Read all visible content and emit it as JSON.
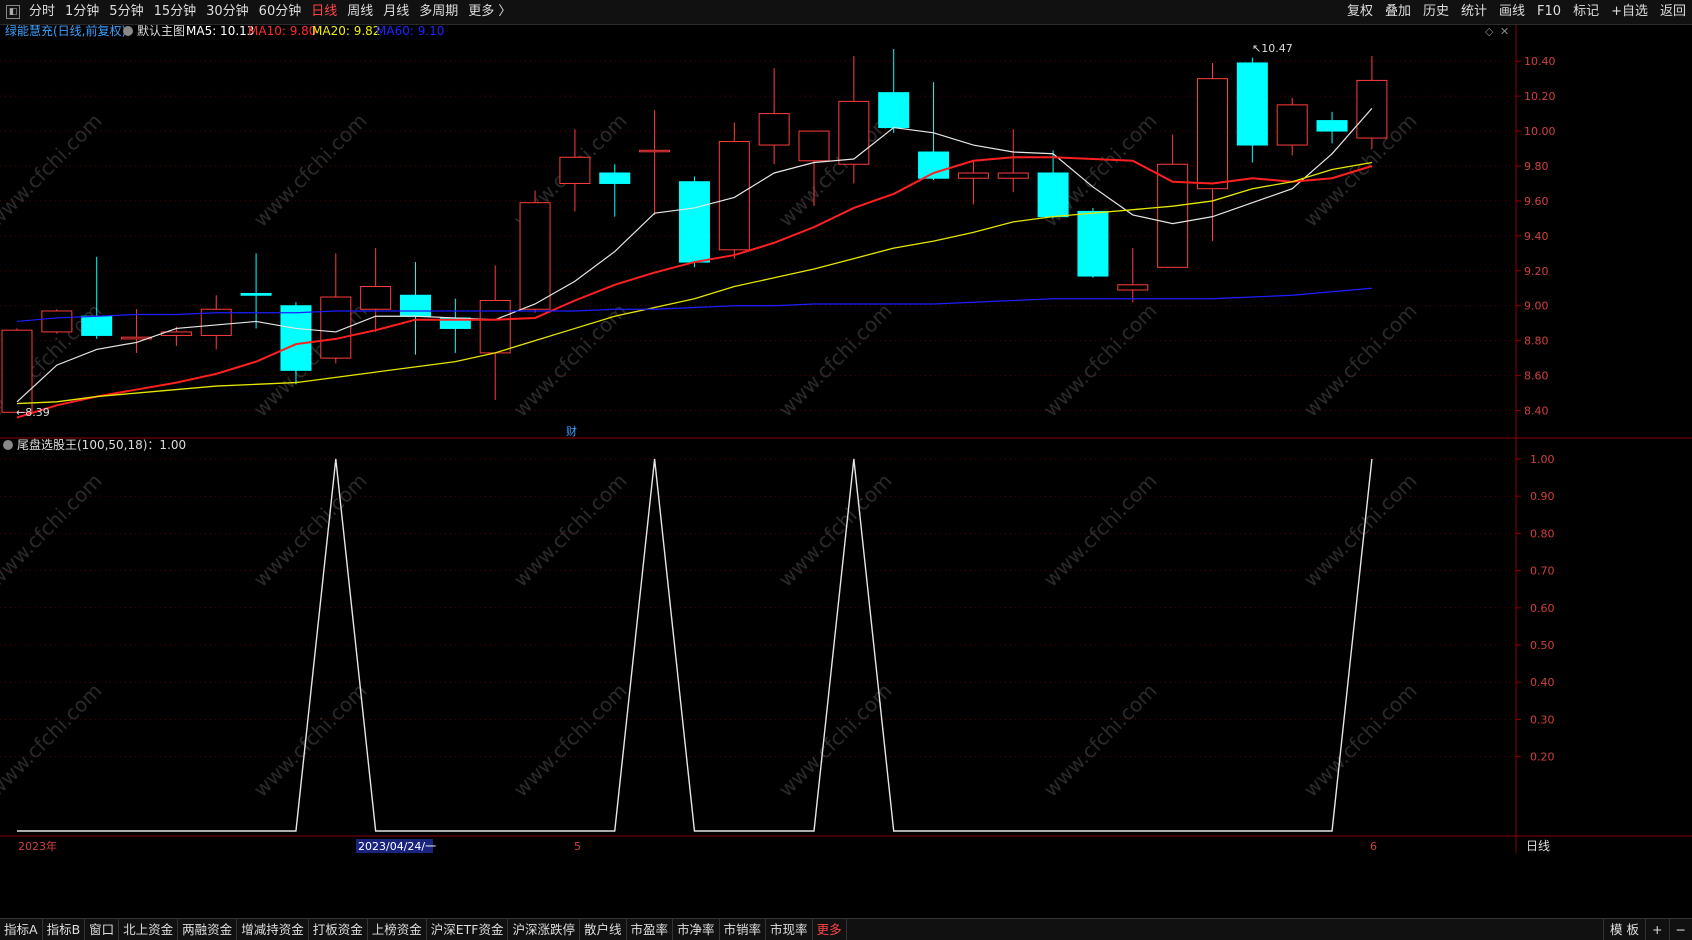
{
  "topbar": {
    "periods": [
      "分时",
      "1分钟",
      "5分钟",
      "15分钟",
      "30分钟",
      "60分钟",
      "日线",
      "周线",
      "月线",
      "多周期",
      "更多 〉"
    ],
    "active_period": "日线",
    "actions": [
      "复权",
      "叠加",
      "历史",
      "统计",
      "画线",
      "F10",
      "标记",
      "+自选",
      "返回"
    ]
  },
  "main_panel": {
    "stock_name": "绿能慧充(日线,前复权)",
    "template": "默认主图",
    "ma_labels": [
      {
        "text": "MA5: 10.13",
        "color": "#ffffff"
      },
      {
        "text": "MA10: 9.80",
        "color": "#ff2b2b"
      },
      {
        "text": "MA20: 9.82",
        "color": "#f0f000"
      },
      {
        "text": "MA60: 9.10",
        "color": "#2323ff"
      }
    ],
    "high_marker": "10.47",
    "low_marker": "8.39",
    "finance_marker": "财",
    "y_ticks": [
      "10.40",
      "10.20",
      "10.00",
      "9.80",
      "9.60",
      "9.40",
      "9.20",
      "9.00",
      "8.80",
      "8.60",
      "8.40"
    ]
  },
  "indicator_panel": {
    "title": "尾盘选股王(100,50,18)：1.00",
    "y_ticks": [
      "1.00",
      "0.90",
      "0.80",
      "0.70",
      "0.60",
      "0.50",
      "0.40",
      "0.30",
      "0.20"
    ]
  },
  "x_axis": {
    "labels": [
      "2023年",
      "5",
      "6"
    ],
    "cursor_label": "2023/04/24/一",
    "period_label": "日线"
  },
  "watermark": "www.cfchi.com",
  "bottombar": {
    "tabs": [
      "指标A",
      "指标B",
      "窗口",
      "北上资金",
      "两融资金",
      "增减持资金",
      "打板资金",
      "上榜资金",
      "沪深ETF资金",
      "沪深涨跌停",
      "散户线",
      "市盈率",
      "市净率",
      "市销率",
      "市现率",
      "更多"
    ],
    "right": [
      "模 板",
      "+",
      "−"
    ]
  },
  "colors": {
    "up": "#ff3c3c",
    "down": "#00ffff",
    "ma5": "#e6e6e6",
    "ma10": "#ff2020",
    "ma20": "#e6e600",
    "ma60": "#1e1eff",
    "indicator": "#e6e6e6",
    "grid": "#5a0000"
  },
  "chart_data": [
    {
      "type": "candlestick",
      "title": "绿能慧充(日线,前复权)",
      "ylim": [
        8.3,
        10.55
      ],
      "candles": [
        {
          "o": 8.39,
          "h": 8.87,
          "l": 8.39,
          "c": 8.86
        },
        {
          "o": 8.85,
          "h": 8.98,
          "l": 8.84,
          "c": 8.97
        },
        {
          "o": 8.94,
          "h": 9.28,
          "l": 8.81,
          "c": 8.83
        },
        {
          "o": 8.81,
          "h": 8.98,
          "l": 8.73,
          "c": 8.82
        },
        {
          "o": 8.83,
          "h": 8.88,
          "l": 8.77,
          "c": 8.85
        },
        {
          "o": 8.83,
          "h": 9.06,
          "l": 8.75,
          "c": 8.98
        },
        {
          "o": 9.07,
          "h": 9.3,
          "l": 8.87,
          "c": 9.06
        },
        {
          "o": 9.0,
          "h": 9.02,
          "l": 8.55,
          "c": 8.63
        },
        {
          "o": 8.7,
          "h": 9.3,
          "l": 8.67,
          "c": 9.05
        },
        {
          "o": 8.98,
          "h": 9.33,
          "l": 8.85,
          "c": 9.11
        },
        {
          "o": 9.06,
          "h": 9.25,
          "l": 8.72,
          "c": 8.94
        },
        {
          "o": 8.93,
          "h": 9.04,
          "l": 8.73,
          "c": 8.87
        },
        {
          "o": 8.73,
          "h": 9.23,
          "l": 8.46,
          "c": 9.03
        },
        {
          "o": 8.98,
          "h": 9.66,
          "l": 8.96,
          "c": 9.59
        },
        {
          "o": 9.7,
          "h": 10.01,
          "l": 9.54,
          "c": 9.85
        },
        {
          "o": 9.76,
          "h": 9.81,
          "l": 9.51,
          "c": 9.7
        },
        {
          "o": 9.89,
          "h": 10.12,
          "l": 9.52,
          "c": 9.89
        },
        {
          "o": 9.71,
          "h": 9.74,
          "l": 9.22,
          "c": 9.25
        },
        {
          "o": 9.32,
          "h": 10.05,
          "l": 9.27,
          "c": 9.94
        },
        {
          "o": 9.92,
          "h": 10.36,
          "l": 9.81,
          "c": 10.1
        },
        {
          "o": 9.83,
          "h": 10.0,
          "l": 9.57,
          "c": 10.0
        },
        {
          "o": 9.81,
          "h": 10.43,
          "l": 9.7,
          "c": 10.17
        },
        {
          "o": 10.22,
          "h": 10.47,
          "l": 9.99,
          "c": 10.02
        },
        {
          "o": 9.88,
          "h": 10.28,
          "l": 9.72,
          "c": 9.73
        },
        {
          "o": 9.73,
          "h": 9.83,
          "l": 9.58,
          "c": 9.76
        },
        {
          "o": 9.73,
          "h": 10.01,
          "l": 9.65,
          "c": 9.76
        },
        {
          "o": 9.76,
          "h": 9.89,
          "l": 9.5,
          "c": 9.51
        },
        {
          "o": 9.54,
          "h": 9.56,
          "l": 9.16,
          "c": 9.17
        },
        {
          "o": 9.09,
          "h": 9.33,
          "l": 9.02,
          "c": 9.12
        },
        {
          "o": 9.22,
          "h": 9.98,
          "l": 9.22,
          "c": 9.81
        },
        {
          "o": 9.67,
          "h": 10.39,
          "l": 9.37,
          "c": 10.3
        },
        {
          "o": 10.39,
          "h": 10.42,
          "l": 9.82,
          "c": 9.92
        },
        {
          "o": 9.92,
          "h": 10.19,
          "l": 9.86,
          "c": 10.15
        },
        {
          "o": 10.06,
          "h": 10.11,
          "l": 9.93,
          "c": 10.0
        },
        {
          "o": 9.96,
          "h": 10.43,
          "l": 9.9,
          "c": 10.29
        }
      ],
      "series": [
        {
          "name": "MA5",
          "values": [
            8.45,
            8.66,
            8.75,
            8.79,
            8.87,
            8.89,
            8.91,
            8.87,
            8.85,
            8.94,
            8.94,
            8.93,
            8.92,
            9.01,
            9.14,
            9.31,
            9.53,
            9.56,
            9.62,
            9.76,
            9.82,
            9.84,
            10.02,
            9.99,
            9.92,
            9.88,
            9.87,
            9.68,
            9.52,
            9.47,
            9.51,
            9.59,
            9.67,
            9.87,
            10.13
          ]
        },
        {
          "name": "MA10",
          "values": [
            8.36,
            8.43,
            8.48,
            8.52,
            8.56,
            8.61,
            8.68,
            8.78,
            8.81,
            8.86,
            8.92,
            8.92,
            8.92,
            8.93,
            9.03,
            9.12,
            9.19,
            9.25,
            9.29,
            9.36,
            9.45,
            9.56,
            9.64,
            9.76,
            9.83,
            9.85,
            9.85,
            9.84,
            9.83,
            9.71,
            9.7,
            9.73,
            9.71,
            9.73,
            9.8
          ]
        },
        {
          "name": "MA20",
          "values": [
            8.44,
            8.45,
            8.48,
            8.5,
            8.52,
            8.54,
            8.55,
            8.56,
            8.59,
            8.62,
            8.65,
            8.68,
            8.73,
            8.8,
            8.87,
            8.94,
            8.99,
            9.04,
            9.11,
            9.16,
            9.21,
            9.27,
            9.33,
            9.37,
            9.42,
            9.48,
            9.51,
            9.53,
            9.55,
            9.57,
            9.6,
            9.67,
            9.71,
            9.78,
            9.82
          ]
        },
        {
          "name": "MA60",
          "values": [
            8.91,
            8.93,
            8.94,
            8.95,
            8.95,
            8.96,
            8.96,
            8.96,
            8.97,
            8.97,
            8.97,
            8.97,
            8.97,
            8.97,
            8.97,
            8.98,
            8.98,
            8.99,
            9.0,
            9.0,
            9.01,
            9.01,
            9.01,
            9.01,
            9.02,
            9.03,
            9.04,
            9.04,
            9.04,
            9.04,
            9.04,
            9.05,
            9.06,
            9.08,
            9.1
          ]
        }
      ]
    },
    {
      "type": "line",
      "title": "尾盘选股王(100,50,18)",
      "ylim": [
        0,
        1.0
      ],
      "series": [
        {
          "values": [
            0,
            0,
            0,
            0,
            0,
            0,
            0,
            0,
            1,
            0,
            0,
            0,
            0,
            0,
            0,
            0,
            1,
            0,
            0,
            0,
            0,
            1,
            0,
            0,
            0,
            0,
            0,
            0,
            0,
            0,
            0,
            0,
            0,
            0,
            1
          ]
        }
      ]
    }
  ]
}
